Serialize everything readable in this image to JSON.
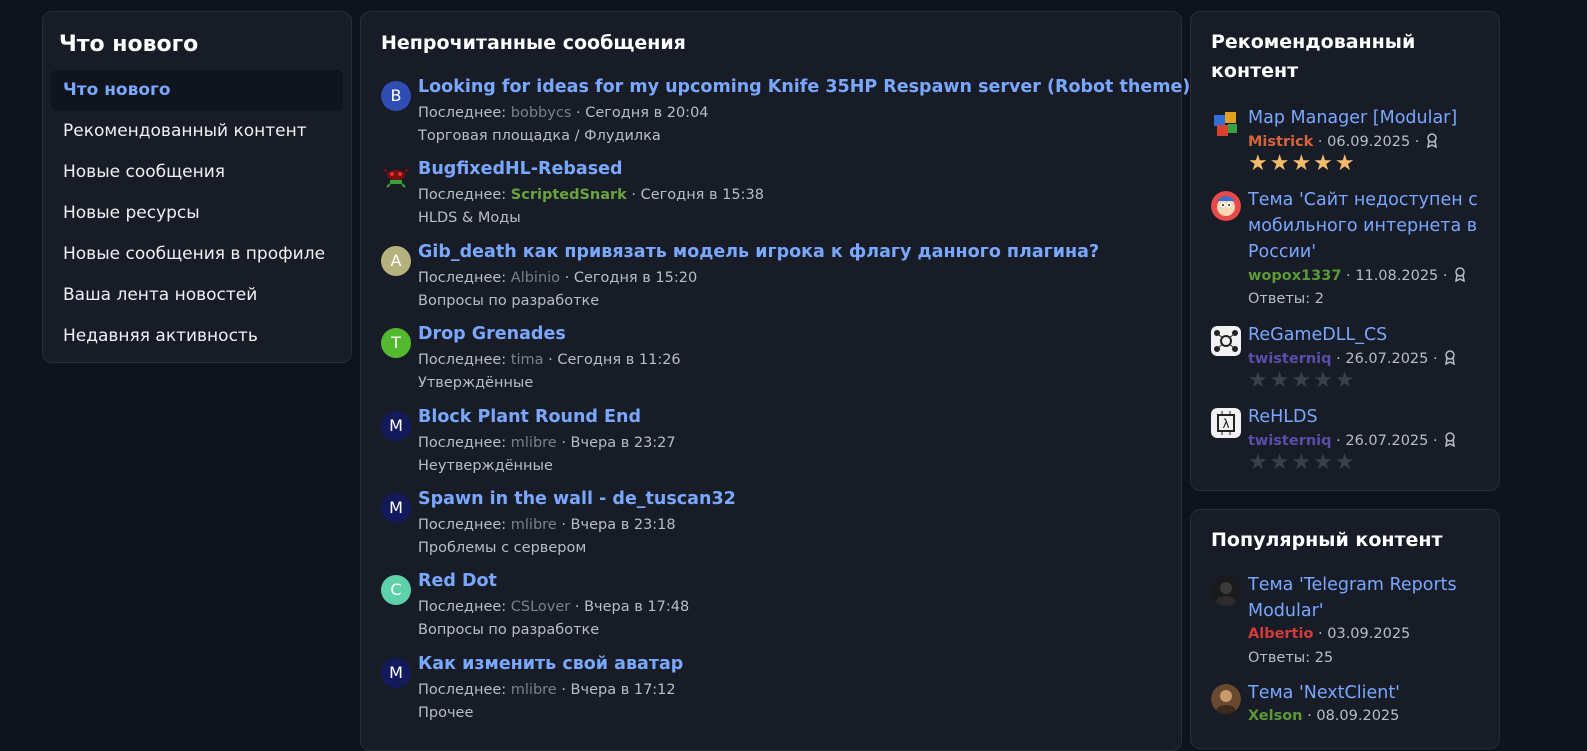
{
  "nav": {
    "title": "Что нового",
    "items": [
      {
        "label": "Что нового",
        "active": true
      },
      {
        "label": "Рекомендованный контент"
      },
      {
        "label": "Новые сообщения"
      },
      {
        "label": "Новые ресурсы"
      },
      {
        "label": "Новые сообщения в профиле"
      },
      {
        "label": "Ваша лента новостей"
      },
      {
        "label": "Недавняя активность"
      }
    ]
  },
  "unread": {
    "title": "Непрочитанные сообщения",
    "last_label": "Последнее: ",
    "threads": [
      {
        "title": "Looking for ideas for my upcoming Knife 35HP Respawn server (Robot theme)",
        "avatar_letter": "B",
        "avatar_color": "#2f4db3",
        "user": "bobbycs",
        "time": " · Сегодня в 20:04",
        "forum": "Торговая площадка / Флудилка"
      },
      {
        "title": "BugfixedHL-Rebased",
        "avatar_letter": "",
        "avatar_icon": "bug-icon",
        "user": "ScriptedSnark",
        "user_green": true,
        "time": " · Сегодня в 15:38",
        "forum": "HLDS & Моды"
      },
      {
        "title": "Gib_death как привязать модель игрока к флагу данного плагина?",
        "avatar_letter": "A",
        "avatar_color": "#b6b27e",
        "user": "Albinio",
        "time": " · Сегодня в 15:20",
        "forum": "Вопросы по разработке"
      },
      {
        "title": "Drop Grenades",
        "avatar_letter": "T",
        "avatar_color": "#55b92f",
        "user": "tima",
        "time": " · Сегодня в 11:26",
        "forum": "Утверждённые"
      },
      {
        "title": "Block Plant Round End",
        "avatar_letter": "M",
        "avatar_color": "#131a5c",
        "user": "mlibre",
        "time": " · Вчера в 23:27",
        "forum": "Неутверждённые"
      },
      {
        "title": "Spawn in the wall - de_tuscan32",
        "avatar_letter": "M",
        "avatar_color": "#131a5c",
        "user": "mlibre",
        "time": " · Вчера в 23:18",
        "forum": "Проблемы с сервером"
      },
      {
        "title": "Red Dot",
        "avatar_letter": "C",
        "avatar_color": "#5fd1a8",
        "user": "CSLover",
        "time": " · Вчера в 17:48",
        "forum": "Вопросы по разработке"
      },
      {
        "title": "Как изменить свой аватар",
        "avatar_letter": "M",
        "avatar_color": "#131a5c",
        "user": "mlibre",
        "time": " · Вчера в 17:12",
        "forum": "Прочее"
      }
    ]
  },
  "featured": {
    "title_line1": "Рекомендованный",
    "title_line2": "контент",
    "items": [
      {
        "title": "Map Manager [Modular]",
        "author": "Mistrick",
        "author_color": "#d7643a",
        "date": " · 06.09.2025 · ",
        "rating": 5,
        "icon": "puzzle-avatar-icon"
      },
      {
        "title": "Тема 'Сайт недоступен с мобильного интернета в России'",
        "author": "wopox1337",
        "author_color": "#5c9a35",
        "date": " · 11.08.2025 · ",
        "replies": "Ответы: 2",
        "icon": "cartoon-avatar-icon"
      },
      {
        "title": "ReGameDLL_CS",
        "author": "twisterniq",
        "author_color": "#5d4da8",
        "date": " · 26.07.2025 · ",
        "rating": 0,
        "icon": "gear-network-icon"
      },
      {
        "title": "ReHLDS",
        "author": "twisterniq",
        "author_color": "#5d4da8",
        "date": " · 26.07.2025 · ",
        "rating": 0,
        "icon": "chip-lambda-icon"
      }
    ]
  },
  "popular": {
    "title": "Популярный контент",
    "items": [
      {
        "title": "Тема 'Telegram Reports Modular'",
        "author": "Albertio",
        "author_color": "#d23b3b",
        "date": " · 03.09.2025",
        "replies": "Ответы: 25",
        "icon": "dark-avatar-icon"
      },
      {
        "title": "Тема 'NextClient'",
        "author": "Xelson",
        "author_color": "#5c9a35",
        "date": " · 08.09.2025",
        "icon": "photo-avatar-icon"
      }
    ]
  },
  "colors": {
    "background": "#0f131b",
    "panel": "#171c26",
    "link": "#7aa7ff",
    "star_on": "#f4bc6a",
    "star_off": "#39404c"
  }
}
